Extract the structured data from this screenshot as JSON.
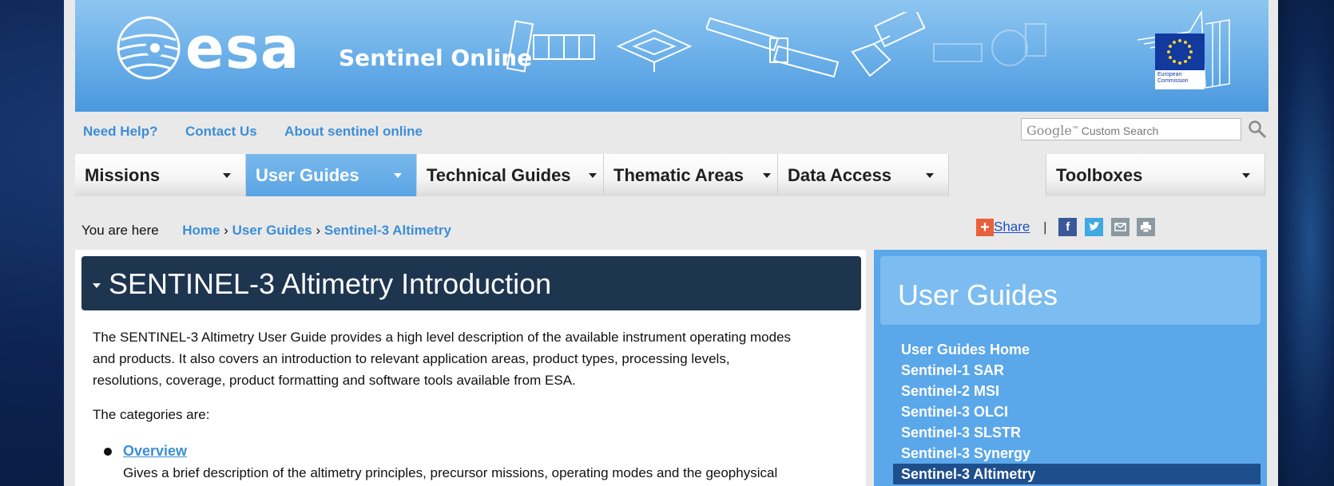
{
  "banner": {
    "logo_text": "esa",
    "site_title": "Sentinel Online",
    "ec_label": "European Commission"
  },
  "toplinks": [
    "Need Help?",
    "Contact Us",
    "About sentinel online"
  ],
  "search": {
    "brand": "Google",
    "tm": "™",
    "placeholder": "Custom Search"
  },
  "nav": {
    "items": [
      {
        "label": "Missions"
      },
      {
        "label": "User Guides"
      },
      {
        "label": "Technical Guides"
      },
      {
        "label": "Thematic Areas"
      },
      {
        "label": "Data Access"
      },
      {
        "label": "Toolboxes"
      }
    ]
  },
  "breadcrumb": {
    "prefix": "You are here",
    "items": [
      "Home",
      "User Guides",
      "Sentinel-3 Altimetry"
    ],
    "separator": "›"
  },
  "share": {
    "label": "Share",
    "separator": "|"
  },
  "main": {
    "title": "SENTINEL-3 Altimetry Introduction",
    "paragraph_lines": [
      "The SENTINEL-3 Altimetry User Guide provides a high level description of the available instrument operating modes",
      "and products. It also covers an introduction to relevant application areas, product types, processing levels,",
      "resolutions, coverage, product formatting and software tools available from ESA."
    ],
    "categories_label": "The categories are:",
    "overview_link": "Overview",
    "overview_desc": "Gives a brief description of the altimetry principles, precursor missions, operating modes and the geophysical"
  },
  "sidebar": {
    "title": "User Guides",
    "items": [
      "User Guides Home",
      "Sentinel-1 SAR",
      "Sentinel-2 MSI",
      "Sentinel-3 OLCI",
      "Sentinel-3 SLSTR",
      "Sentinel-3 Synergy",
      "Sentinel-3 Altimetry"
    ],
    "active_item": "Sentinel-3 Altimetry"
  },
  "colors": {
    "link": "#3b8ed6",
    "banner": "#6fb2ea",
    "title_bar": "#1e3550",
    "sidebar": "#5aa7ea",
    "active_nav": "#5aa4e4"
  },
  "icons": [
    "esa-globe-icon",
    "satellite-icon",
    "eu-flag-icon",
    "search-icon",
    "facebook-icon",
    "twitter-icon",
    "email-icon",
    "print-icon",
    "share-plus-icon",
    "chevron-down-icon"
  ]
}
